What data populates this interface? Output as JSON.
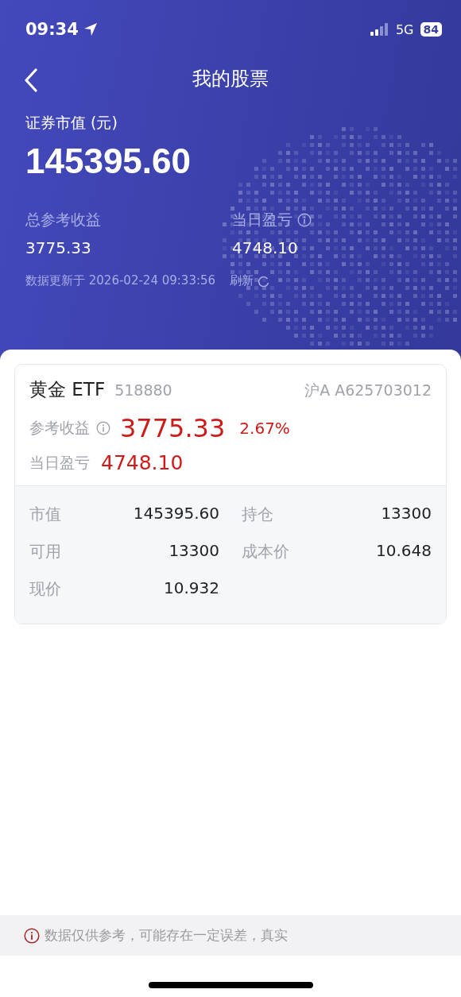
{
  "status_bar": {
    "time": "09:34",
    "network": "5G",
    "battery": "84"
  },
  "nav": {
    "title": "我的股票"
  },
  "summary": {
    "label": "证券市值 (元)",
    "value": "145395.60",
    "metrics": [
      {
        "label": "总参考收益",
        "value": "3775.33",
        "info": false
      },
      {
        "label": "当日盈亏",
        "value": "4748.10",
        "info": true
      }
    ],
    "updated": "数据更新于 2026-02-24 09:33:56",
    "refresh": "刷新"
  },
  "holding": {
    "name": "黄金 ETF",
    "code": "518880",
    "account": "沪A A625703012",
    "profit_label": "参考收益",
    "profit": "3775.33",
    "profit_pct": "2.67%",
    "daily_label": "当日盈亏",
    "daily": "4748.10",
    "stats": [
      {
        "label": "市值",
        "value": "145395.60"
      },
      {
        "label": "持仓",
        "value": "13300"
      },
      {
        "label": "可用",
        "value": "13300"
      },
      {
        "label": "成本价",
        "value": "10.648"
      },
      {
        "label": "现价",
        "value": "10.932"
      }
    ]
  },
  "disclaimer": "数据仅供参考，可能存在一定误差，真实"
}
